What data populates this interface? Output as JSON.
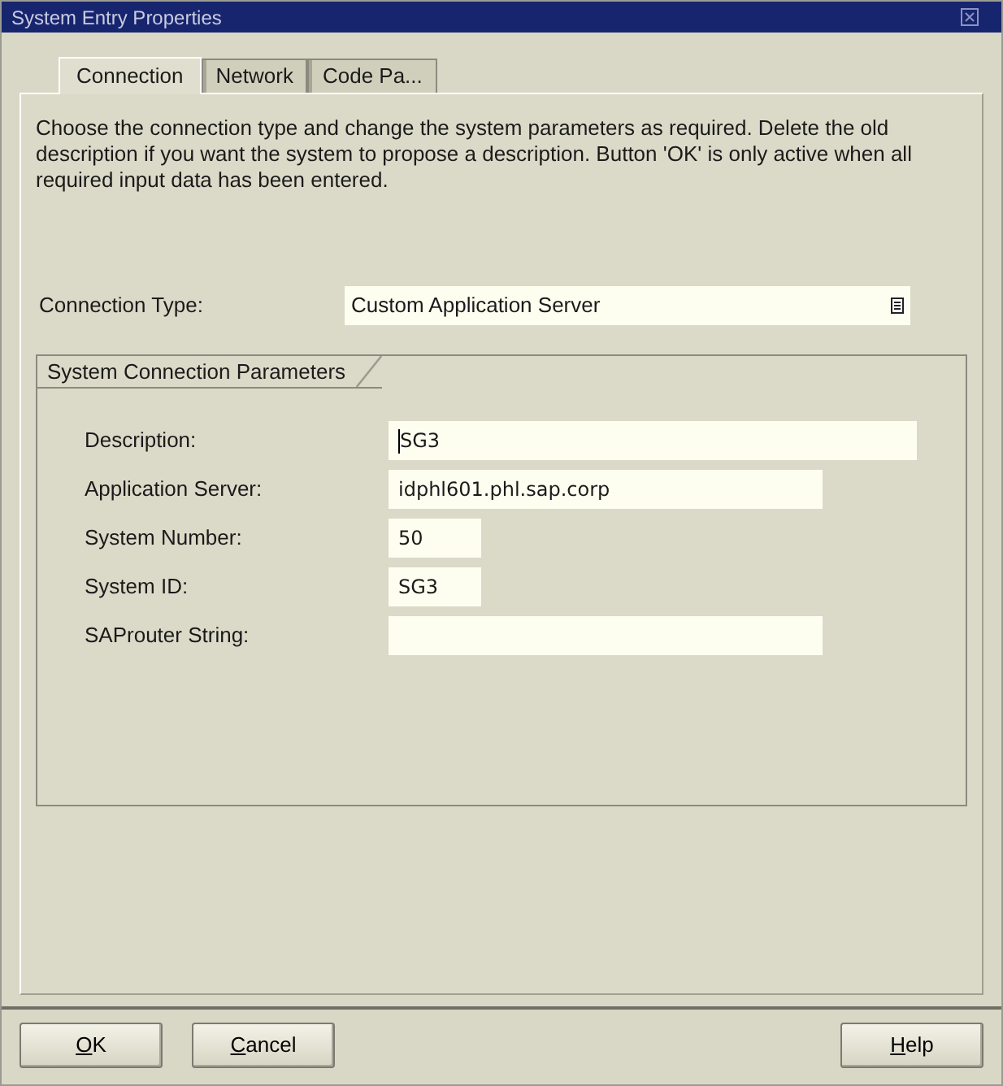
{
  "window": {
    "title": "System Entry Properties"
  },
  "tabs": [
    {
      "label": "Connection",
      "selected": true
    },
    {
      "label": "Network",
      "selected": false
    },
    {
      "label": "Code Pa...",
      "selected": false
    }
  ],
  "instructions": "Choose the connection type and change the system parameters as required. Delete the old description if you want the system to propose a description. Button 'OK' is only active when all required input data has been entered.",
  "connection_type": {
    "label": "Connection Type:",
    "value": "Custom Application Server"
  },
  "group": {
    "title": "System Connection Parameters",
    "fields": [
      {
        "label": "Description:",
        "value": "SG3",
        "focused": true
      },
      {
        "label": "Application Server:",
        "value": "idphl601.phl.sap.corp",
        "focused": false
      },
      {
        "label": "System Number:",
        "value": "50",
        "focused": false
      },
      {
        "label": "System ID:",
        "value": "SG3",
        "focused": false
      },
      {
        "label": "SAProuter String:",
        "focused": false
      }
    ]
  },
  "buttons_left": [
    {
      "key": "O",
      "rest": "K"
    },
    {
      "key": "C",
      "rest": "ancel"
    }
  ],
  "buttons_right": [
    {
      "key": "H",
      "rest": "elp"
    }
  ]
}
